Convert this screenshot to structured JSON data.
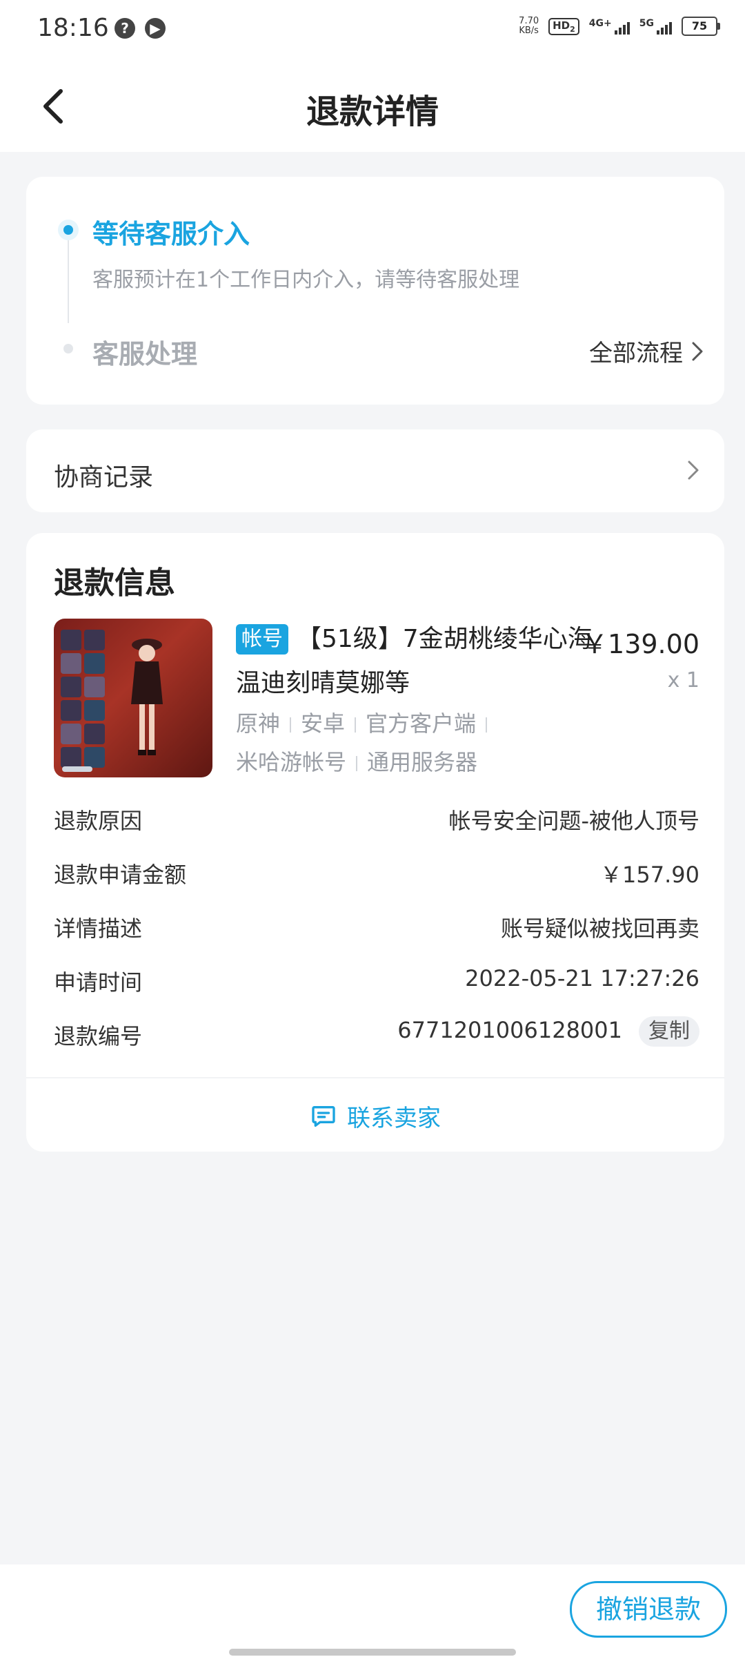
{
  "status_bar": {
    "time": "18:16",
    "net_speed_value": "7.70",
    "net_speed_unit": "KB/s",
    "hd_badge": "HD",
    "hd_sub": "2",
    "sig1_label": "4G+",
    "sig2_label": "5G",
    "battery": "75",
    "icon1": "settings-circle-icon",
    "icon2": "play-circle-icon"
  },
  "header": {
    "title": "退款详情",
    "back_icon": "chevron-left-icon"
  },
  "progress": {
    "step1_title": "等待客服介入",
    "step1_desc": "客服预计在1个工作日内介入，请等待客服处理",
    "step2_title": "客服处理",
    "all_flow_label": "全部流程"
  },
  "negotiation": {
    "label": "协商记录"
  },
  "refund_info": {
    "title": "退款信息",
    "product": {
      "tag": "帐号",
      "title": "【51级】7金胡桃绫华心海温迪刻晴莫娜等",
      "price": "￥139.00",
      "qty": "x 1",
      "attrs": [
        "原神",
        "安卓",
        "官方客户端",
        "米哈游帐号",
        "通用服务器"
      ]
    },
    "rows": [
      {
        "label": "退款原因",
        "value": "帐号安全问题-被他人顶号"
      },
      {
        "label": "退款申请金额",
        "value": "￥157.90"
      },
      {
        "label": "详情描述",
        "value": "账号疑似被找回再卖"
      },
      {
        "label": "申请时间",
        "value": "2022-05-21 17:27:26"
      },
      {
        "label": "退款编号",
        "value": "6771201006128001"
      }
    ],
    "copy_label": "复制",
    "contact_label": "联系卖家"
  },
  "bottom": {
    "cancel_label": "撤销退款"
  },
  "colors": {
    "accent": "#1aa4e0",
    "muted": "#9a9ea5",
    "background": "#f4f5f7"
  }
}
